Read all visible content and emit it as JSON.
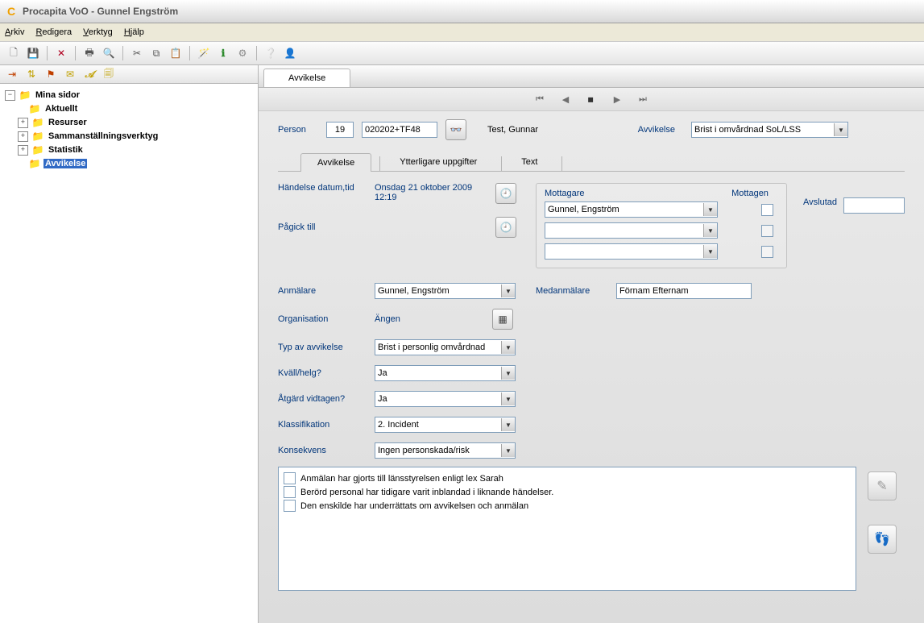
{
  "window": {
    "title": "Procapita VoO - Gunnel Engström"
  },
  "menu": {
    "arkiv": "Arkiv",
    "redigera": "Redigera",
    "verktyg": "Verktyg",
    "hjalp": "Hjälp"
  },
  "tree": {
    "root": "Mina sidor",
    "aktuellt": "Aktuellt",
    "resurser": "Resurser",
    "sammanst": "Sammanställningsverktyg",
    "statistik": "Statistik",
    "avvikelse": "Avvikelse"
  },
  "doc_tab": "Avvikelse",
  "header": {
    "person_label": "Person",
    "person_num": "19",
    "person_code": "020202+TF48",
    "person_name": "Test, Gunnar",
    "avvikelse_label": "Avvikelse",
    "avvikelse_value": "Brist i omvårdnad SoL/LSS"
  },
  "inner_tabs": {
    "avvikelse": "Avvikelse",
    "ytterligare": "Ytterligare uppgifter",
    "text": "Text"
  },
  "form": {
    "handelse_label": "Händelse datum,tid",
    "handelse_value": "Onsdag 21 oktober 2009 12:19",
    "pagick_label": "Pågick till",
    "mottagare_label": "Mottagare",
    "mottagen_label": "Mottagen",
    "avslutad_label": "Avslutad",
    "mottagare1": "Gunnel, Engström",
    "anmalare_label": "Anmälare",
    "anmalare_value": "Gunnel, Engström",
    "medanmalare_label": "Medanmälare",
    "medanmalare_value": "Förnam Efternam",
    "organisation_label": "Organisation",
    "organisation_value": "Ängen",
    "typ_label": "Typ av avvikelse",
    "typ_value": "Brist i personlig omvårdnad",
    "kvall_label": "Kväll/helg?",
    "kvall_value": "Ja",
    "atgard_label": "Åtgärd vidtagen?",
    "atgard_value": "Ja",
    "klass_label": "Klassifikation",
    "klass_value": "2. Incident",
    "konsekvens_label": "Konsekvens",
    "konsekvens_value": "Ingen personskada/risk",
    "check1": "Anmälan har gjorts till länsstyrelsen enligt lex Sarah",
    "check2": "Berörd personal har tidigare varit inblandad i liknande händelser.",
    "check3": "Den enskilde har underrättats om avvikelsen och anmälan"
  }
}
